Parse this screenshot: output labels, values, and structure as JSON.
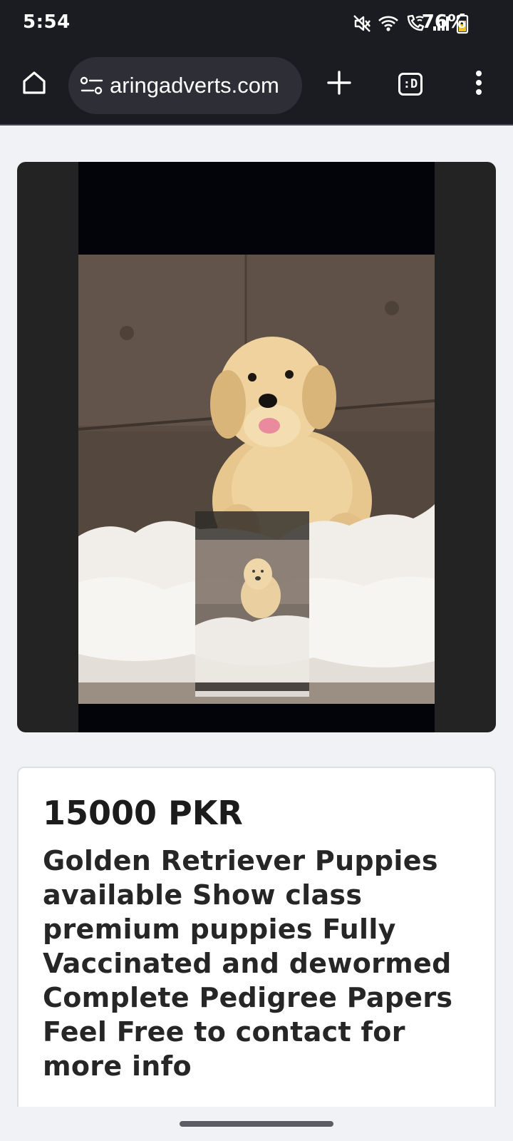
{
  "status_bar": {
    "time": "5:54",
    "battery_percent": "76%",
    "icons": [
      "mute-icon",
      "wifi-icon",
      "wifi-calling-icon",
      "signal-icon",
      "battery-icon"
    ]
  },
  "browser": {
    "url_display": "aringadverts.com",
    "tab_switcher_label": ":D",
    "icons": [
      "home-icon",
      "site-settings-icon",
      "plus-icon",
      "tab-switcher-icon",
      "more-vert-icon"
    ]
  },
  "listing": {
    "price": "15000 PKR",
    "description": "Golden Retriever Puppies available Show class premium puppies Fully Vaccinated and dewormed Complete Pedigree Papers Feel Free to contact for more info"
  },
  "colors": {
    "toolbar_bg": "#1b1c21",
    "page_bg": "#f1f2f5",
    "media_card_bg": "#232323",
    "text_dark": "#262626"
  }
}
